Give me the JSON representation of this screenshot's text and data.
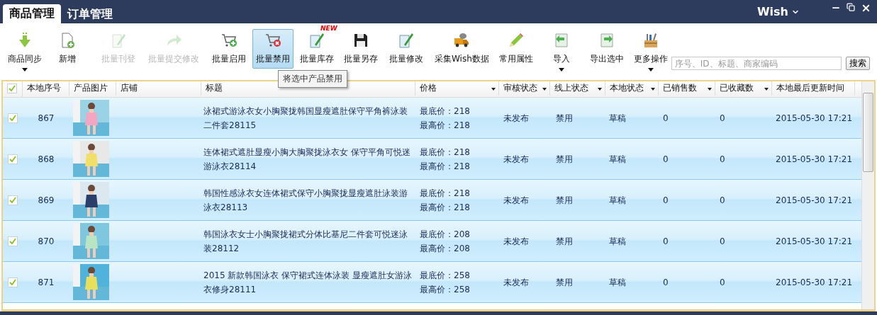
{
  "tabs": [
    {
      "label": "商品管理",
      "selected": true
    },
    {
      "label": "订单管理",
      "selected": false
    }
  ],
  "platform": {
    "label": "Wish"
  },
  "toolbar": [
    {
      "label": "商品同步",
      "disabled": false,
      "selected": false,
      "dropdown": true
    },
    {
      "label": "新增",
      "disabled": false,
      "selected": false,
      "dropdown": false
    },
    {
      "label": "批量刊登",
      "disabled": true,
      "selected": false,
      "dropdown": false
    },
    {
      "label": "批量提交修改",
      "disabled": true,
      "selected": false,
      "dropdown": false
    },
    {
      "label": "批量启用",
      "disabled": false,
      "selected": false,
      "dropdown": false
    },
    {
      "label": "批量禁用",
      "disabled": false,
      "selected": true,
      "dropdown": false,
      "tooltip": "将选中产品禁用"
    },
    {
      "label": "批量库存",
      "disabled": false,
      "selected": false,
      "dropdown": false,
      "badge": "NEW"
    },
    {
      "label": "批量另存",
      "disabled": false,
      "selected": false,
      "dropdown": false
    },
    {
      "label": "批量修改",
      "disabled": false,
      "selected": false,
      "dropdown": false
    },
    {
      "label": "采集Wish数据",
      "disabled": false,
      "selected": false,
      "dropdown": false
    },
    {
      "label": "常用属性",
      "disabled": false,
      "selected": false,
      "dropdown": false
    },
    {
      "label": "导入",
      "disabled": false,
      "selected": false,
      "dropdown": true
    },
    {
      "label": "导出选中",
      "disabled": false,
      "selected": false,
      "dropdown": false
    },
    {
      "label": "更多操作",
      "disabled": false,
      "selected": false,
      "dropdown": true
    }
  ],
  "search": {
    "placeholder": "序号、ID、标题、商家编码",
    "button": "搜索"
  },
  "table": {
    "all_checked": true,
    "columns": [
      {
        "label": "本地序号",
        "filter": false
      },
      {
        "label": "产品图片",
        "filter": false
      },
      {
        "label": "店铺",
        "filter": false
      },
      {
        "label": "标题",
        "filter": false
      },
      {
        "label": "价格",
        "filter": true
      },
      {
        "label": "审核状态",
        "filter": true
      },
      {
        "label": "线上状态",
        "filter": true
      },
      {
        "label": "本地状态",
        "filter": true
      },
      {
        "label": "已销售数",
        "filter": true
      },
      {
        "label": "已收藏数",
        "filter": true
      },
      {
        "label": "本地最后更新时间",
        "filter": false
      }
    ],
    "rows": [
      {
        "checked": true,
        "no": "867",
        "title": "泳裙式游泳衣女小胸聚拢韩国显瘦遮肚保守平角裤泳装二件套28115",
        "min_price": "最底价：218",
        "max_price": "最高价：218",
        "review": "未发布",
        "online": "禁用",
        "local": "草稿",
        "sold": "0",
        "favorited": "0",
        "updated": "2015-05-30 17:21"
      },
      {
        "checked": true,
        "no": "868",
        "title": "连体裙式遮肚显瘦小胸大胸聚拢泳衣女 保守平角可悦迷游泳衣28114",
        "min_price": "最底价：218",
        "max_price": "最高价：218",
        "review": "未发布",
        "online": "禁用",
        "local": "草稿",
        "sold": "0",
        "favorited": "0",
        "updated": "2015-05-30 17:21"
      },
      {
        "checked": true,
        "no": "869",
        "title": "韩国性感泳衣女连体裙式保守小胸聚拢显瘦遮肚泳装游泳衣28113",
        "min_price": "最底价：218",
        "max_price": "最高价：218",
        "review": "未发布",
        "online": "禁用",
        "local": "草稿",
        "sold": "0",
        "favorited": "0",
        "updated": "2015-05-30 17:21"
      },
      {
        "checked": true,
        "no": "870",
        "title": "韩国泳衣女士小胸聚拢裙式分体比基尼二件套可悦迷泳装28112",
        "min_price": "最底价：208",
        "max_price": "最高价：208",
        "review": "未发布",
        "online": "禁用",
        "local": "草稿",
        "sold": "0",
        "favorited": "0",
        "updated": "2015-05-30 17:21"
      },
      {
        "checked": true,
        "no": "871",
        "title": "2015 新款韩国泳衣 保守裙式连体泳装 显瘦遮肚女游泳衣修身28111",
        "min_price": "最底价：258",
        "max_price": "最高价：258",
        "review": "未发布",
        "online": "禁用",
        "local": "草稿",
        "sold": "0",
        "favorited": "0",
        "updated": "2015-05-30 17:21"
      }
    ]
  }
}
